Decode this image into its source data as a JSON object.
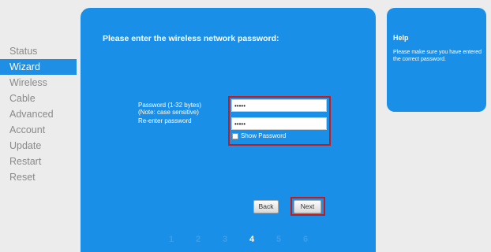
{
  "sidebar": {
    "items": [
      {
        "label": "Status"
      },
      {
        "label": "Wizard",
        "active": true
      },
      {
        "label": "Wireless"
      },
      {
        "label": "Cable"
      },
      {
        "label": "Advanced"
      },
      {
        "label": "Account"
      },
      {
        "label": "Update"
      },
      {
        "label": "Restart"
      },
      {
        "label": "Reset"
      }
    ]
  },
  "main": {
    "title": "Please enter the wireless network password:",
    "password_label": "Password (1-32 bytes)",
    "password_note": "(Note: case sensitive)",
    "password_value": "•••••",
    "reenter_label": "Re-enter password",
    "reenter_value": "•••••",
    "show_password_label": "Show Password",
    "show_password_checked": false,
    "back_label": "Back",
    "next_label": "Next",
    "steps": [
      "1",
      "2",
      "3",
      "4",
      "5",
      "6"
    ],
    "current_step": "4"
  },
  "help": {
    "title": "Help",
    "text": "Please make sure you have entered the correct password."
  },
  "colors": {
    "panel_blue": "#1a8fe8",
    "active_nav": "#1f8fe6",
    "highlight_red": "#c41a1a"
  }
}
